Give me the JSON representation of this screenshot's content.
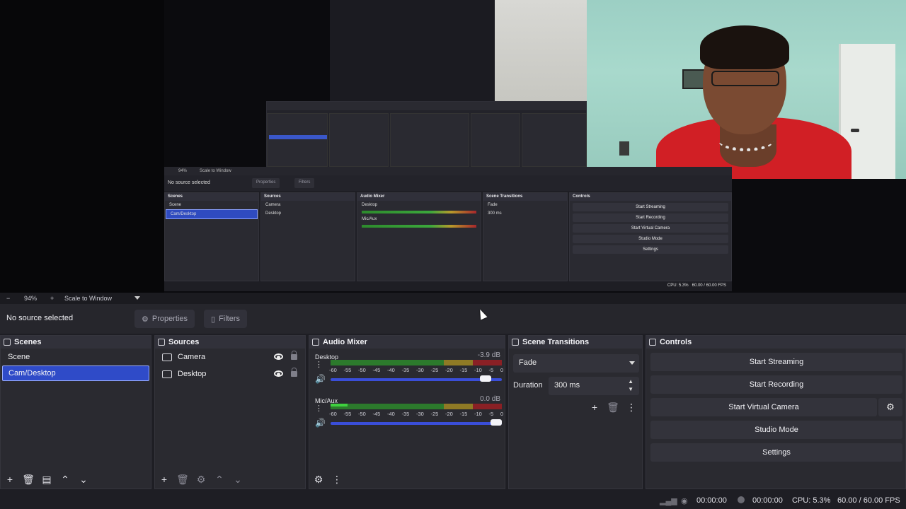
{
  "toolbar": {
    "zoom": "94%",
    "scale_mode": "Scale to Window"
  },
  "source_bar": {
    "no_source": "No source selected",
    "properties": "Properties",
    "filters": "Filters"
  },
  "scenes": {
    "title": "Scenes",
    "items": [
      {
        "label": "Scene"
      },
      {
        "label": "Cam/Desktop"
      }
    ],
    "selected_index": 1
  },
  "sources": {
    "title": "Sources",
    "items": [
      {
        "label": "Camera"
      },
      {
        "label": "Desktop"
      }
    ]
  },
  "mixer": {
    "title": "Audio Mixer",
    "ticks": [
      "-60",
      "-55",
      "-50",
      "-45",
      "-40",
      "-35",
      "-30",
      "-25",
      "-20",
      "-15",
      "-10",
      "-5",
      "0"
    ],
    "channels": [
      {
        "name": "Desktop",
        "db": "-3.9 dB",
        "volume": 0.94
      },
      {
        "name": "Mic/Aux",
        "db": "0.0 dB",
        "volume": 1.0
      }
    ]
  },
  "transitions": {
    "title": "Scene Transitions",
    "selected": "Fade",
    "duration_label": "Duration",
    "duration": "300 ms"
  },
  "controls": {
    "title": "Controls",
    "start_streaming": "Start Streaming",
    "start_recording": "Start Recording",
    "start_virtual_camera": "Start Virtual Camera",
    "studio_mode": "Studio Mode",
    "settings": "Settings"
  },
  "status": {
    "stream_time": "00:00:00",
    "record_time": "00:00:00",
    "cpu": "CPU: 5.3%",
    "fps": "60.00 / 60.00 FPS"
  },
  "colors": {
    "accent": "#2f4bc8",
    "volume_slider": "#3a4ed8"
  }
}
